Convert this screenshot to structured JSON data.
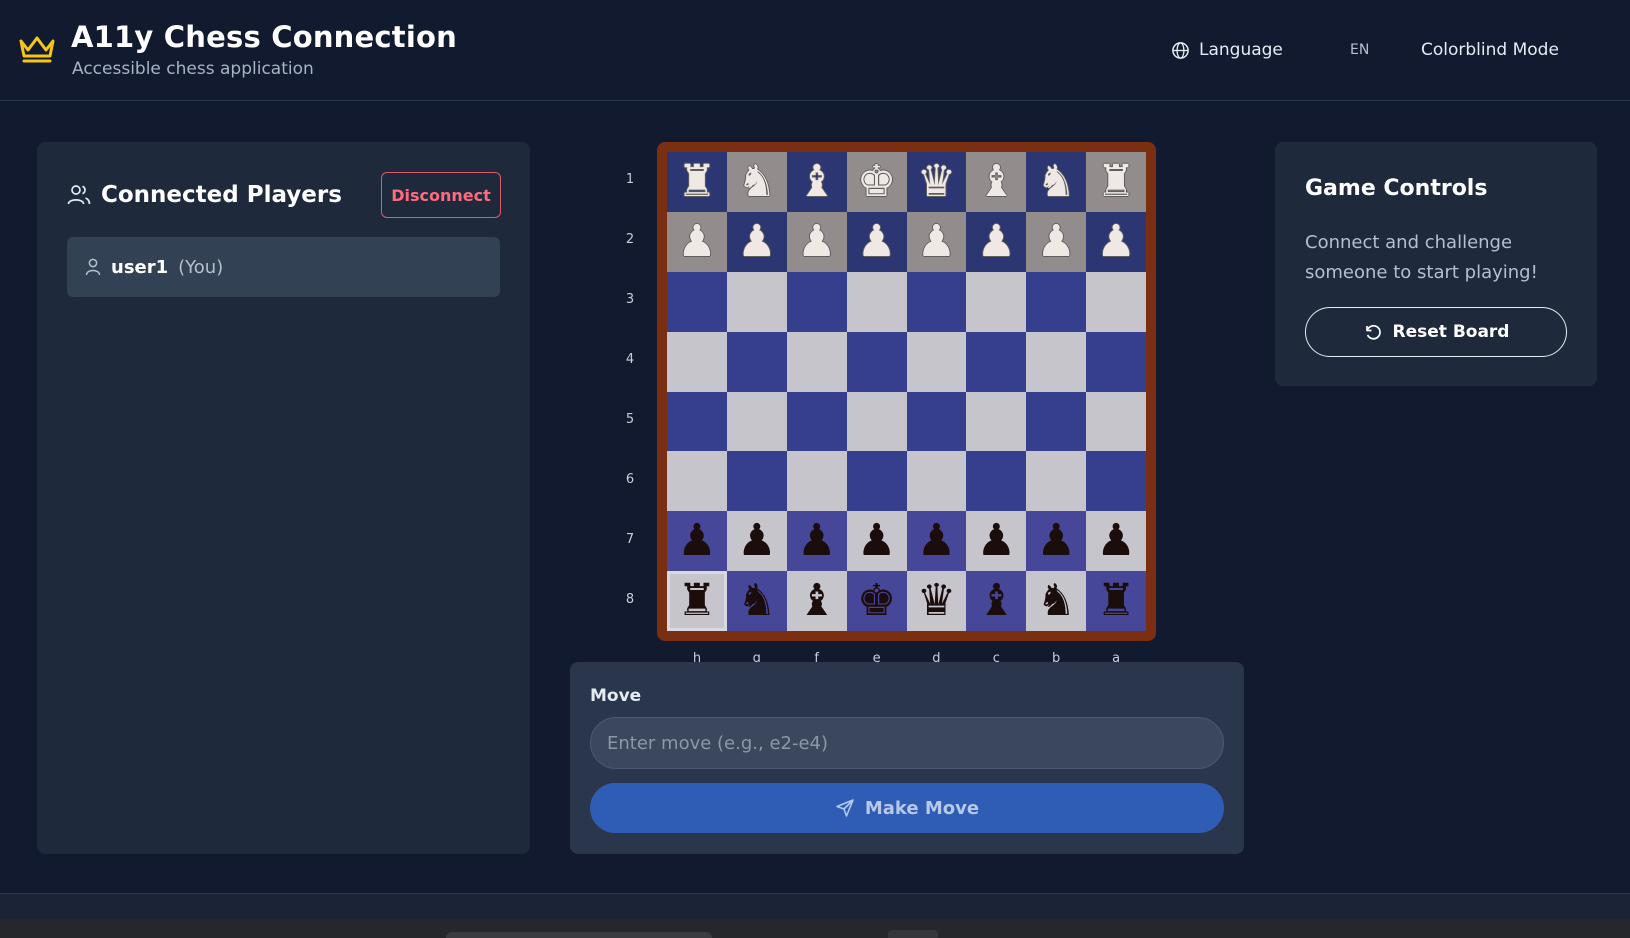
{
  "header": {
    "title": "A11y Chess Connection",
    "subtitle": "Accessible chess application",
    "language_label": "Language",
    "language_code": "EN",
    "colorblind_label": "Colorblind Mode"
  },
  "players": {
    "title": "Connected Players",
    "disconnect_label": "Disconnect",
    "list": [
      {
        "name": "user1",
        "tag": "(You)"
      }
    ]
  },
  "board": {
    "ranks": [
      "1",
      "2",
      "3",
      "4",
      "5",
      "6",
      "7",
      "8"
    ],
    "files": [
      "h",
      "g",
      "f",
      "e",
      "d",
      "c",
      "b",
      "a"
    ],
    "rows": [
      [
        "♜",
        "♞",
        "♝",
        "♚",
        "♛",
        "♝",
        "♞",
        "♜"
      ],
      [
        "♟",
        "♟",
        "♟",
        "♟",
        "♟",
        "♟",
        "♟",
        "♟"
      ],
      [
        "",
        "",
        "",
        "",
        "",
        "",
        "",
        ""
      ],
      [
        "",
        "",
        "",
        "",
        "",
        "",
        "",
        ""
      ],
      [
        "",
        "",
        "",
        "",
        "",
        "",
        "",
        ""
      ],
      [
        "",
        "",
        "",
        "",
        "",
        "",
        "",
        ""
      ],
      [
        "♟",
        "♟",
        "♟",
        "♟",
        "♟",
        "♟",
        "♟",
        "♟"
      ],
      [
        "♜",
        "♞",
        "♝",
        "♚",
        "♛",
        "♝",
        "♞",
        "♜"
      ]
    ],
    "white_rows": [
      0,
      1
    ],
    "selected_square": "h8"
  },
  "move": {
    "label": "Move",
    "placeholder": "Enter move (e.g., e2-e4)",
    "value": "",
    "button_label": "Make Move"
  },
  "controls": {
    "title": "Game Controls",
    "text": "Connect and challenge someone to start playing!",
    "reset_label": "Reset Board"
  },
  "colors": {
    "accent": "#2f5db5",
    "danger": "#ff6b7c",
    "board_dark": "#353f8e",
    "board_light": "#c7c5cc",
    "board_frame": "#7a2e12",
    "logo": "#f5c518"
  }
}
